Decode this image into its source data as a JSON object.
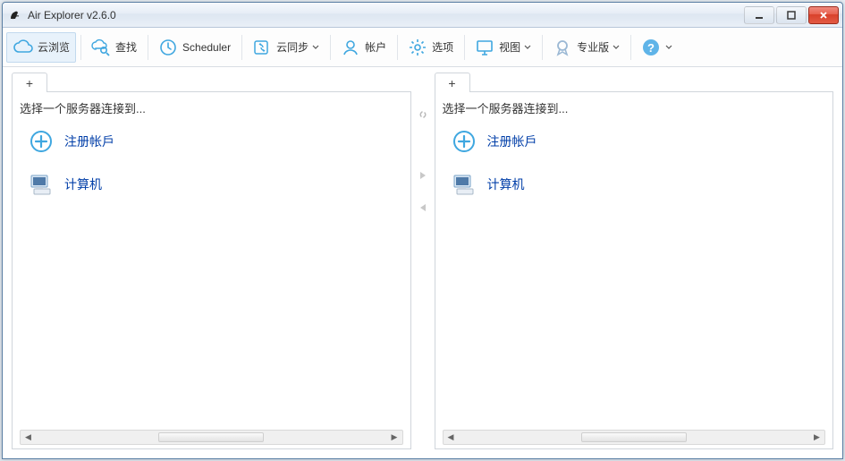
{
  "window": {
    "title": "Air Explorer v2.6.0"
  },
  "toolbar": {
    "items": [
      {
        "id": "browse",
        "label": "云浏览",
        "icon": "cloud-outline-icon",
        "dropdown": false,
        "active": true
      },
      {
        "id": "search",
        "label": "查找",
        "icon": "cloud-search-icon",
        "dropdown": false
      },
      {
        "id": "scheduler",
        "label": "Scheduler",
        "icon": "clock-icon",
        "dropdown": false
      },
      {
        "id": "sync",
        "label": "云同步",
        "icon": "sync-icon",
        "dropdown": true
      },
      {
        "id": "accounts",
        "label": "帐户",
        "icon": "user-icon",
        "dropdown": false
      },
      {
        "id": "options",
        "label": "选项",
        "icon": "gear-icon",
        "dropdown": false
      },
      {
        "id": "view",
        "label": "视图",
        "icon": "monitor-icon",
        "dropdown": true
      },
      {
        "id": "pro",
        "label": "专业版",
        "icon": "badge-icon",
        "dropdown": true
      },
      {
        "id": "help",
        "label": "",
        "icon": "help-icon",
        "dropdown": true
      }
    ]
  },
  "panes": {
    "left": {
      "tab_plus": "+",
      "prompt": "选择一个服务器连接到...",
      "entries": [
        {
          "label": "注册帐戶",
          "icon": "plus-circle-icon"
        },
        {
          "label": "计算机",
          "icon": "computer-icon"
        }
      ]
    },
    "right": {
      "tab_plus": "+",
      "prompt": "选择一个服务器连接到...",
      "entries": [
        {
          "label": "注册帐戶",
          "icon": "plus-circle-icon"
        },
        {
          "label": "计算机",
          "icon": "computer-icon"
        }
      ]
    }
  }
}
